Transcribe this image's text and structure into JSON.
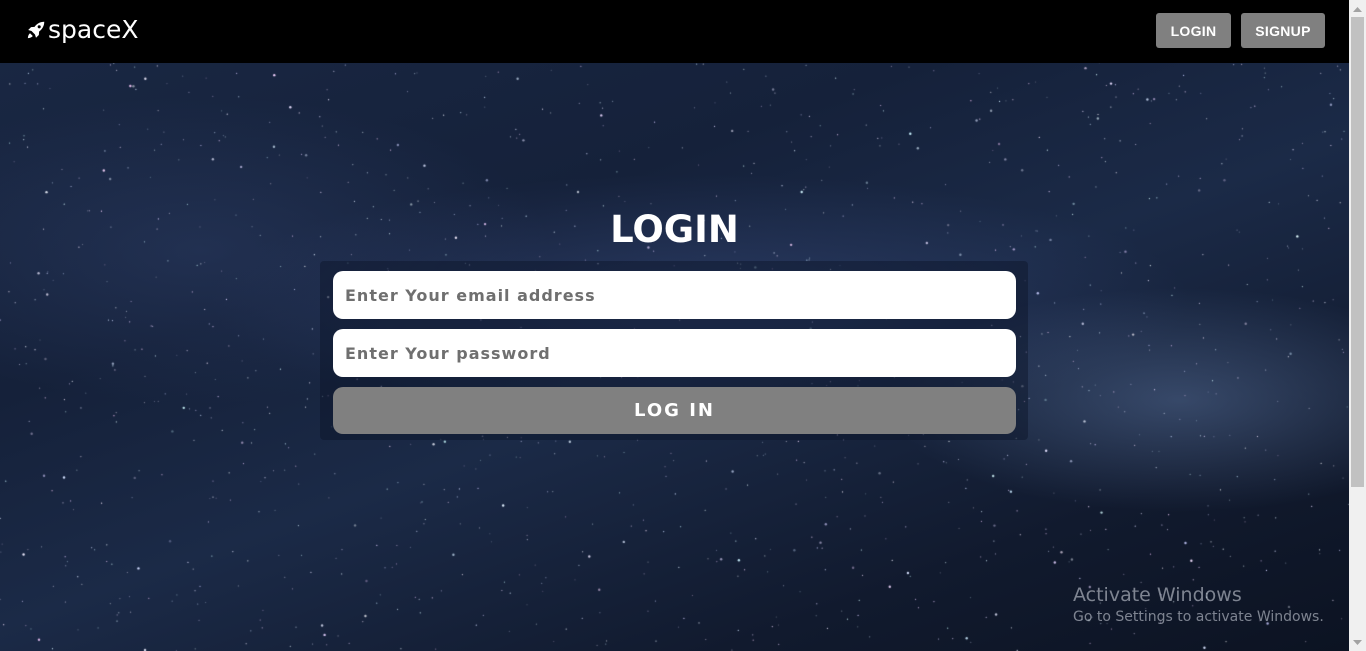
{
  "navbar": {
    "brand": "spaceX",
    "brand_icon": "rocket-icon",
    "login_label": "LOGIN",
    "signup_label": "SIGNUP"
  },
  "form": {
    "title": "LOGIN",
    "email_placeholder": "Enter Your email address",
    "email_value": "",
    "password_placeholder": "Enter Your password",
    "password_value": "",
    "submit_label": "LOG IN"
  },
  "watermark": {
    "title": "Activate Windows",
    "subtitle": "Go to Settings to activate Windows."
  },
  "colors": {
    "navbar_bg": "#000000",
    "button_bg": "#808080",
    "text": "#ffffff"
  }
}
